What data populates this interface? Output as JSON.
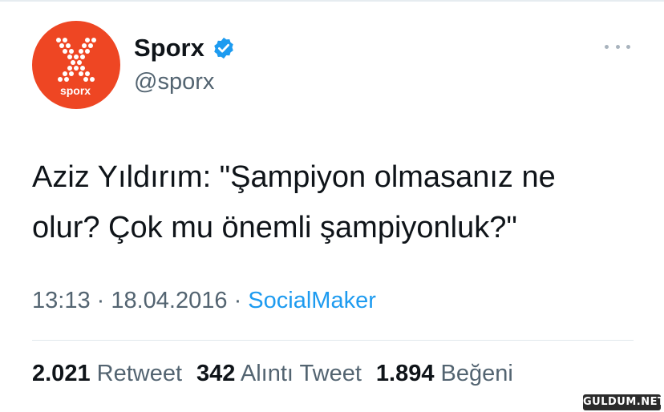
{
  "profile": {
    "name": "Sporx",
    "handle": "@sporx",
    "avatar_text": "sporx",
    "brand_color": "#ee4623",
    "verified_color": "#1d9bf0"
  },
  "menu": {
    "icon": "more-dots-icon"
  },
  "tweet": {
    "line1": "Aziz Yıldırım: \"Şampiyon olmasanız ne",
    "line2": "olur? Çok mu önemli şampiyonluk?\""
  },
  "meta": {
    "time": "13:13",
    "separator": " · ",
    "date": "18.04.2016",
    "source": "SocialMaker"
  },
  "stats": {
    "retweets": {
      "count": "2.021",
      "label": "Retweet"
    },
    "quotes": {
      "count": "342",
      "label": "Alıntı Tweet"
    },
    "likes": {
      "count": "1.894",
      "label": "Beğeni"
    }
  },
  "watermark": "GULDUM.NET"
}
